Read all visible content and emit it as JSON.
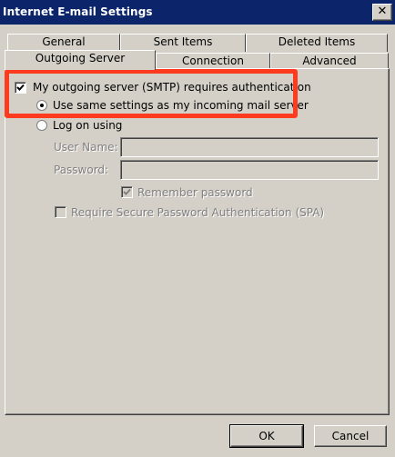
{
  "window": {
    "title": "Internet E-mail Settings",
    "close_glyph": "✕"
  },
  "tabs_back_row": [
    "General",
    "Sent Items",
    "Deleted Items"
  ],
  "tabs_front_row": [
    "Outgoing Server",
    "Connection",
    "Advanced"
  ],
  "active_tab": "Outgoing Server",
  "outgoing": {
    "requires_auth_label": "My outgoing server (SMTP) requires authentication",
    "requires_auth_checked": true,
    "use_same_label": "Use same settings as my incoming mail server",
    "use_same_selected": true,
    "log_on_using_label": "Log on using",
    "log_on_using_selected": false,
    "user_name_label": "User Name:",
    "user_name_value": "",
    "password_label": "Password:",
    "password_value": "",
    "remember_password_label": "Remember password",
    "remember_password_checked": true,
    "spa_label": "Require Secure Password Authentication (SPA)",
    "spa_checked": false
  },
  "buttons": {
    "ok": "OK",
    "cancel": "Cancel"
  },
  "annotation_color": "#ff3b1f"
}
